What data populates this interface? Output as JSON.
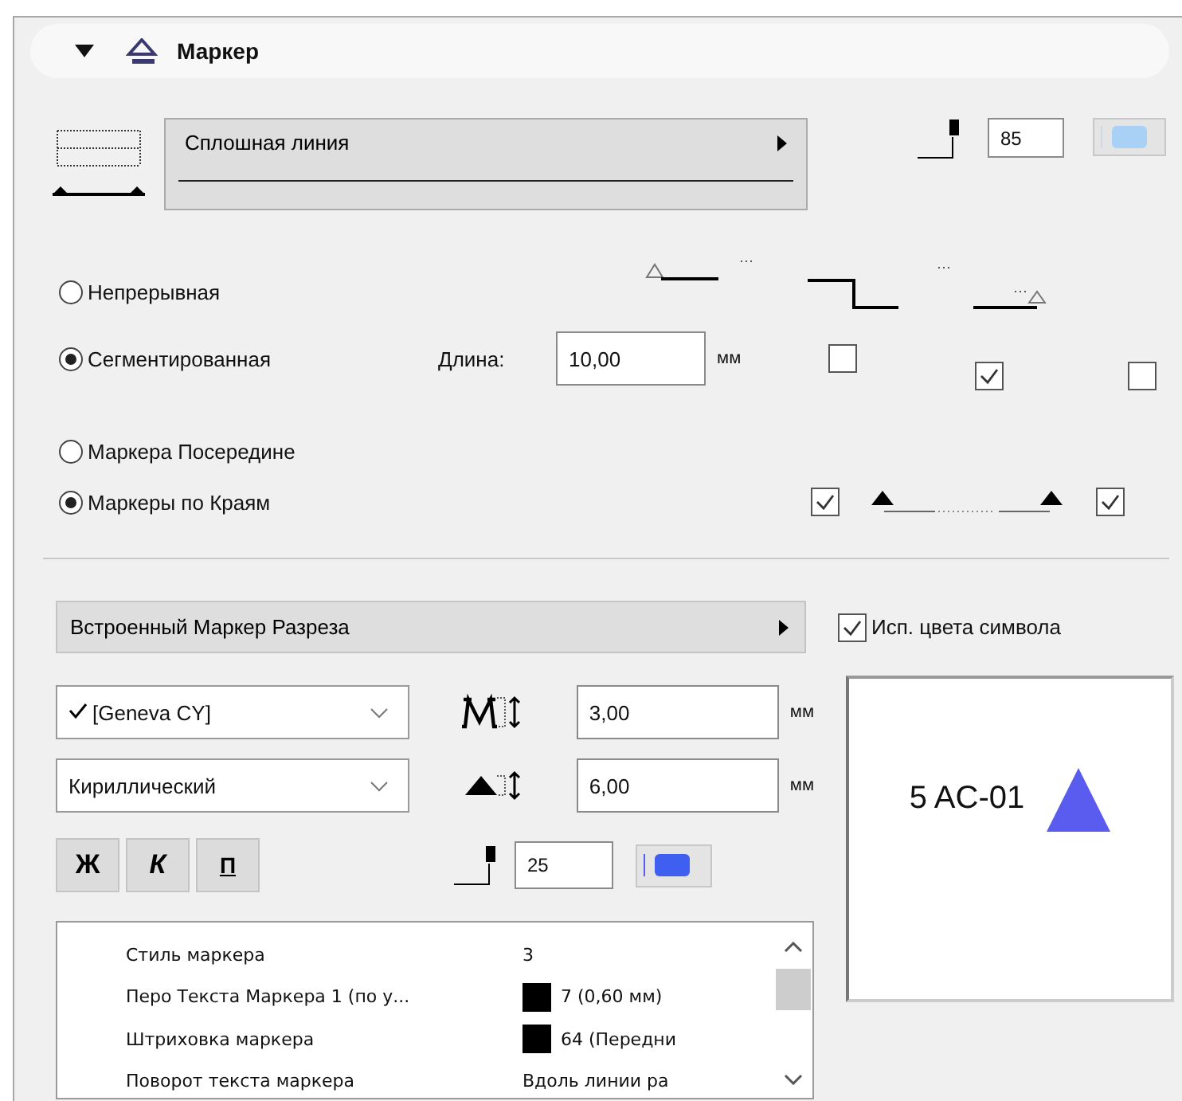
{
  "section": {
    "title": "Маркер",
    "expanded": true
  },
  "line_type": {
    "label": "Сплошная линия"
  },
  "line_pen": {
    "value": "85"
  },
  "segment_mode": [
    {
      "label": "Непрерывная",
      "selected": false
    },
    {
      "label": "Сегментированная",
      "selected": true
    }
  ],
  "length": {
    "label": "Длина:",
    "value": "10,00",
    "unit": "мм"
  },
  "segment_checks": [
    {
      "checked": false
    },
    {
      "checked": true
    },
    {
      "checked": false
    }
  ],
  "marker_position": [
    {
      "label": "Маркера Посередине",
      "selected": false
    },
    {
      "label": "Маркеры по Краям",
      "selected": true
    }
  ],
  "edge_checks": [
    {
      "checked": true
    },
    {
      "checked": true
    }
  ],
  "marker_type": {
    "label": "Встроенный Маркер Разреза"
  },
  "use_symbol_colors": {
    "label": "Исп. цвета символа",
    "checked": true
  },
  "font": {
    "value": "[Geneva CY]",
    "checked": true
  },
  "script": {
    "value": "Кириллический"
  },
  "text_height": {
    "value": "3,00",
    "unit": "мм"
  },
  "marker_height": {
    "value": "6,00",
    "unit": "мм"
  },
  "style_buttons": [
    {
      "label": "Ж",
      "kind": "bold"
    },
    {
      "label": "К",
      "kind": "italic"
    },
    {
      "label": "П",
      "kind": "underline"
    }
  ],
  "marker_pen": {
    "value": "25"
  },
  "preview": {
    "text": "5 AC-01"
  },
  "properties": [
    {
      "name": "Стиль маркера",
      "value": "3",
      "swatch": false
    },
    {
      "name": "Перо Текста Маркера 1 (по у...",
      "value": "7 (0,60 мм)",
      "swatch": true
    },
    {
      "name": "Штриховка маркера",
      "value": "64 (Передни",
      "swatch": true
    },
    {
      "name": "Поворот текста маркера",
      "value": "Вдоль линии ра",
      "swatch": false
    }
  ]
}
